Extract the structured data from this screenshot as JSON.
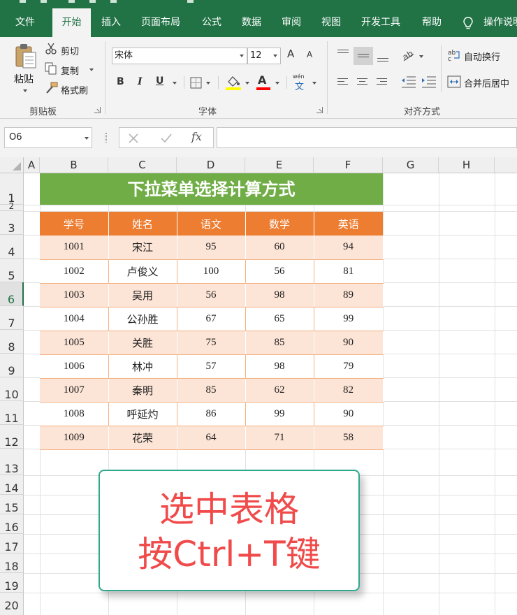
{
  "ribbon": {
    "tabs": [
      "文件",
      "开始",
      "插入",
      "页面布局",
      "公式",
      "数据",
      "审阅",
      "视图",
      "开发工具",
      "帮助",
      "操作说明"
    ],
    "active_tab": "开始",
    "clipboard": {
      "paste": "粘贴",
      "cut": "剪切",
      "copy": "复制",
      "format_painter": "格式刷",
      "group": "剪贴板"
    },
    "font": {
      "name": "宋体",
      "size": "12",
      "group": "字体",
      "bold": "B",
      "italic": "I",
      "underline": "U",
      "font_color": "A",
      "grow": "A",
      "shrink": "A",
      "phonetic_top": "wén",
      "phonetic_bottom": "文"
    },
    "alignment": {
      "wrap_text": "自动换行",
      "merge_center": "合并后居中",
      "group": "对齐方式"
    }
  },
  "formula_bar": {
    "name_box": "O6",
    "fx": "fx",
    "formula": ""
  },
  "colors": {
    "brand": "#217346",
    "title_bg": "#70ad47",
    "header_bg": "#ed7d31",
    "band_bg": "#fce4d6",
    "callout_text": "#f04a4a",
    "callout_border": "#30a890"
  },
  "grid": {
    "columns": [
      "A",
      "B",
      "C",
      "D",
      "E",
      "F",
      "G",
      "H"
    ],
    "rows": [
      "1",
      "2",
      "3",
      "4",
      "5",
      "6",
      "7",
      "8",
      "9",
      "10",
      "11",
      "12",
      "13",
      "14",
      "15",
      "16",
      "17",
      "18",
      "19",
      "20"
    ],
    "selected_row": "6"
  },
  "sheet": {
    "title": "下拉菜单选择计算方式",
    "headers": [
      "学号",
      "姓名",
      "语文",
      "数学",
      "英语"
    ],
    "rows": [
      [
        "1001",
        "宋江",
        "95",
        "60",
        "94"
      ],
      [
        "1002",
        "卢俊义",
        "100",
        "56",
        "81"
      ],
      [
        "1003",
        "吴用",
        "56",
        "98",
        "89"
      ],
      [
        "1004",
        "公孙胜",
        "67",
        "65",
        "99"
      ],
      [
        "1005",
        "关胜",
        "75",
        "85",
        "90"
      ],
      [
        "1006",
        "林冲",
        "57",
        "98",
        "79"
      ],
      [
        "1007",
        "秦明",
        "85",
        "62",
        "82"
      ],
      [
        "1008",
        "呼延灼",
        "86",
        "99",
        "90"
      ],
      [
        "1009",
        "花荣",
        "64",
        "71",
        "58"
      ]
    ]
  },
  "callout": {
    "line1": "选中表格",
    "line2": "按Ctrl+T键"
  }
}
